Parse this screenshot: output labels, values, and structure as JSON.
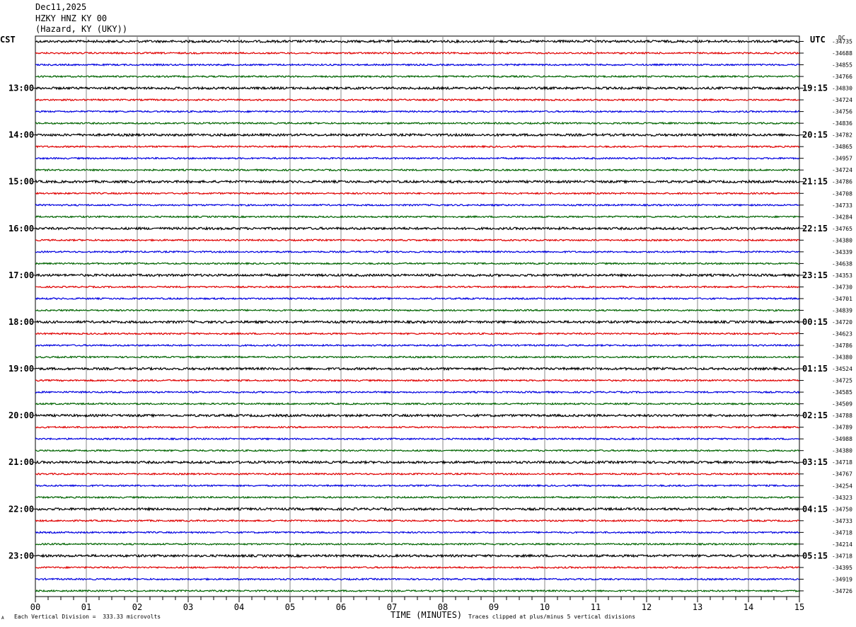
{
  "header": {
    "date": "Dec11,2025",
    "station": "HZKY HNZ KY 00",
    "location": "(Hazard, KY (UKY))"
  },
  "left_axis_label": "CST",
  "right_axis_label": "UTC",
  "dc_label": "DC",
  "footer": {
    "scale_note": "Each Vertical Division =  333.33 microvolts",
    "clip_note": "Traces clipped at plus/minus 5 vertical divisions",
    "corner_mark": "A"
  },
  "chart_data": {
    "type": "line",
    "title": "HZKY HNZ KY 00",
    "xlabel": "TIME (MINUTES)",
    "xlim": [
      0,
      15
    ],
    "x_ticks": [
      "00",
      "01",
      "02",
      "03",
      "04",
      "05",
      "06",
      "07",
      "08",
      "09",
      "10",
      "11",
      "12",
      "13",
      "14",
      "15"
    ],
    "trace_colors": [
      "#000000",
      "#e00000",
      "#0000e0",
      "#006400"
    ],
    "rows_per_hour": 4,
    "minutes_per_row": 15,
    "left_hour_labels": [
      "13:00",
      "14:00",
      "15:00",
      "16:00",
      "17:00",
      "18:00",
      "19:00",
      "20:00",
      "21:00",
      "22:00",
      "23:00"
    ],
    "right_hour_labels": [
      "19:15",
      "20:15",
      "21:15",
      "22:15",
      "23:15",
      "00:15",
      "01:15",
      "02:15",
      "03:15",
      "04:15",
      "05:15"
    ],
    "dc_offsets": [
      "-34735",
      "-34688",
      "-34855",
      "-34766",
      "-34830",
      "-34724",
      "-34756",
      "-34836",
      "-34782",
      "-34865",
      "-34957",
      "-34724",
      "-34786",
      "-34708",
      "-34733",
      "-34284",
      "-34765",
      "-34380",
      "-34339",
      "-34638",
      "-34353",
      "-34730",
      "-34701",
      "-34839",
      "-34720",
      "-34623",
      "-34786",
      "-34380",
      "-34524",
      "-34725",
      "-34585",
      "-34509",
      "-34788",
      "-34789",
      "-34988",
      "-34380",
      "-34718",
      "-34767",
      "-34254",
      "-34323",
      "-34750",
      "-34733",
      "-34718",
      "-34214",
      "-34718",
      "-34395",
      "-34919",
      "-34726"
    ]
  }
}
